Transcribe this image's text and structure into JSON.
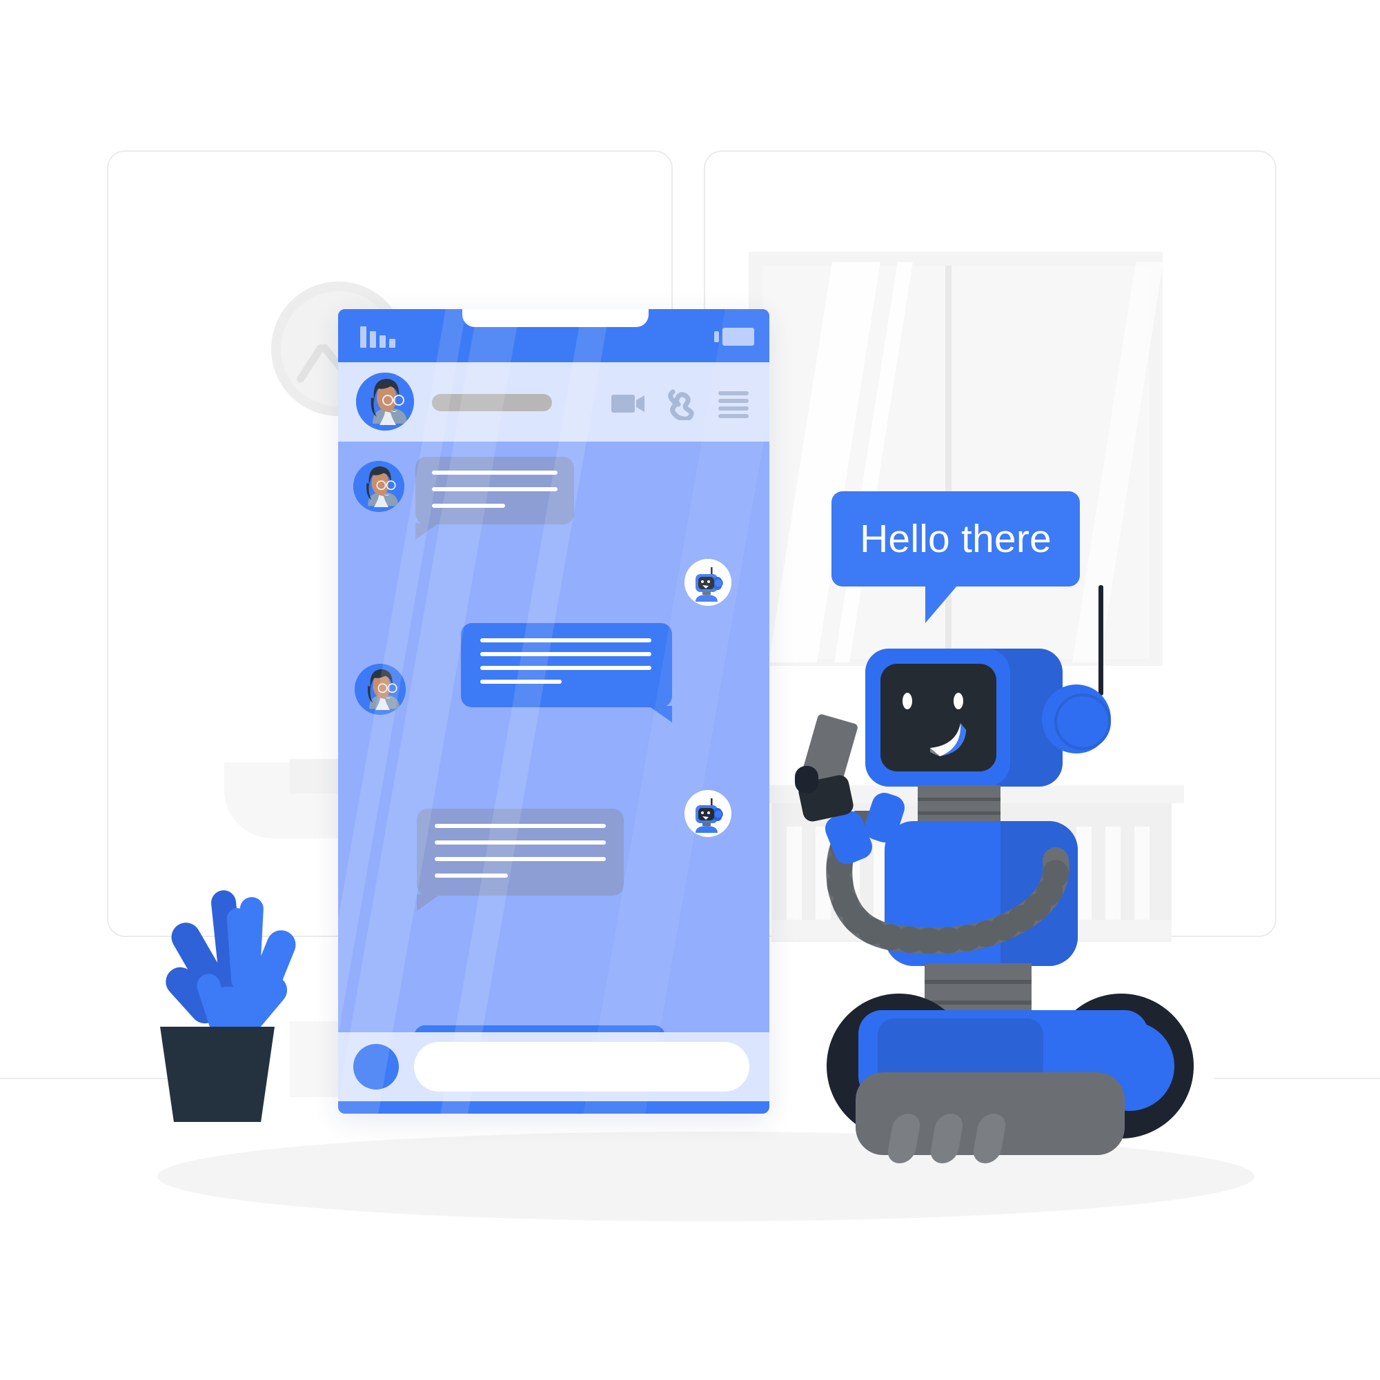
{
  "scene": {
    "title": "Chat bot conversation illustration",
    "description": "A cartoon robot on wheels holding a phone says hello next to a large smartphone showing a chat thread"
  },
  "frames": [
    {
      "name": "left-frame"
    },
    {
      "name": "right-frame"
    }
  ],
  "colors": {
    "primary_blue": "#3d7af5",
    "deep_blue": "#2f6ef0",
    "dark_blue": "#2b62d6",
    "phone_body": "#92aefc",
    "chat_header": "#dbe5fd",
    "bubble_incoming": "#8c9ed3",
    "bubble_outgoing": "#3d7af5",
    "robot_dark": "#242b33",
    "robot_gray": "#6b6f74",
    "pot_dark": "#243240",
    "background": "#ffffff",
    "frame_stroke": "#ebebeb",
    "panel_gray": "#f4f4f4",
    "text_white": "#ffffff"
  },
  "phone": {
    "status_bar": {
      "signal_icon": "signal-bars-icon",
      "signal_bars": 4,
      "battery_icon": "battery-icon",
      "notch": "camera-notch"
    },
    "chat_header": {
      "avatar": "contact-avatar",
      "name_placeholder": "",
      "actions": [
        {
          "name": "video-call-icon",
          "label": "Video call"
        },
        {
          "name": "phone-call-icon",
          "label": "Voice call"
        },
        {
          "name": "menu-icon",
          "label": "Menu"
        }
      ]
    },
    "messages": [
      {
        "sender": "contact",
        "avatar": "contact-avatar",
        "lines": 3,
        "line_widths": [
          100,
          100,
          58
        ],
        "align": "left"
      },
      {
        "sender": "bot",
        "avatar": "bot-avatar",
        "lines": 4,
        "line_widths": [
          100,
          100,
          100,
          46
        ],
        "align": "right"
      },
      {
        "sender": "contact",
        "avatar": "contact-avatar",
        "lines": 4,
        "line_widths": [
          100,
          100,
          100,
          42
        ],
        "align": "left"
      },
      {
        "sender": "bot",
        "avatar": "bot-avatar",
        "lines": 4,
        "line_widths": [
          100,
          100,
          100,
          42
        ],
        "align": "right"
      }
    ],
    "composer": {
      "attach_button": "attach-button",
      "input_placeholder": "",
      "input_value": ""
    }
  },
  "robot": {
    "speech_bubble_text": "Hello there",
    "face": {
      "eyes": 2,
      "expression": "smiling",
      "screen": "robot-face-screen"
    },
    "parts": [
      "antenna",
      "head",
      "ear",
      "neck",
      "torso",
      "arm",
      "hand",
      "held-phone",
      "waist",
      "base",
      "left-wheel",
      "right-wheel"
    ]
  },
  "decor": {
    "clock": {
      "name": "wall-clock",
      "hands": 2
    },
    "plant": {
      "name": "potted-plant",
      "leaf_count": 8
    },
    "window": {
      "name": "window-panel",
      "panes": 2
    },
    "radiator": {
      "name": "radiator",
      "slats": 9
    }
  }
}
